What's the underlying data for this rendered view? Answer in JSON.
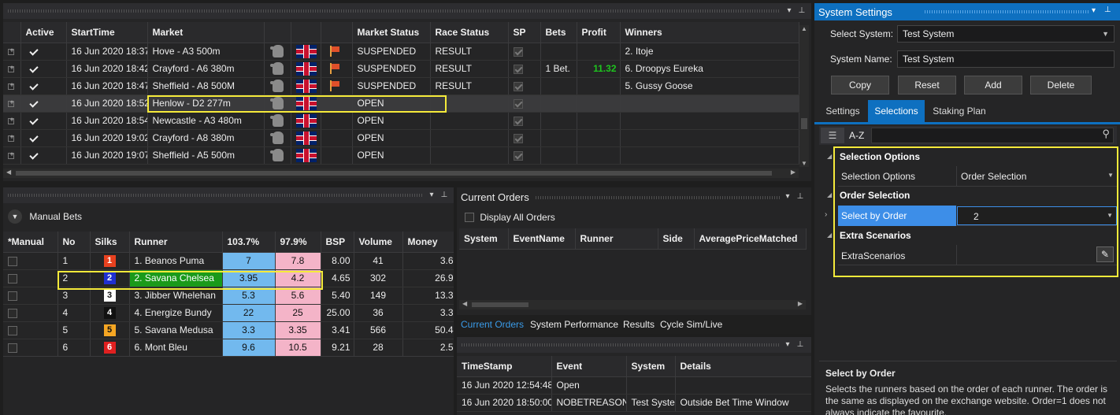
{
  "markets": {
    "headers": [
      "Active",
      "StartTime",
      "Market",
      "",
      "",
      "",
      "Market Status",
      "Race Status",
      "SP",
      "Bets",
      "Profit",
      "Winners"
    ],
    "rows": [
      {
        "time": "16 Jun 2020 18:37",
        "market": "Hove - A3 500m",
        "mstatus": "SUSPENDED",
        "rstatus": "RESULT",
        "bets": "",
        "profit": "",
        "winners": "2. Itoje",
        "flag": true
      },
      {
        "time": "16 Jun 2020 18:42",
        "market": "Crayford - A6 380m",
        "mstatus": "SUSPENDED",
        "rstatus": "RESULT",
        "bets": "1 Bet.",
        "profit": "11.32",
        "winners": "6. Droopys Eureka",
        "flag": true
      },
      {
        "time": "16 Jun 2020 18:47",
        "market": "Sheffield - A8 500M",
        "mstatus": "SUSPENDED",
        "rstatus": "RESULT",
        "bets": "",
        "profit": "",
        "winners": "5. Gussy Goose",
        "flag": true
      },
      {
        "time": "16 Jun 2020 18:52",
        "market": "Henlow - D2 277m",
        "mstatus": "OPEN",
        "rstatus": "",
        "bets": "",
        "profit": "",
        "winners": "",
        "flag": false
      },
      {
        "time": "16 Jun 2020 18:54",
        "market": "Newcastle - A3 480m",
        "mstatus": "OPEN",
        "rstatus": "",
        "bets": "",
        "profit": "",
        "winners": "",
        "flag": false
      },
      {
        "time": "16 Jun 2020 19:02",
        "market": "Crayford - A8 380m",
        "mstatus": "OPEN",
        "rstatus": "",
        "bets": "",
        "profit": "",
        "winners": "",
        "flag": false
      },
      {
        "time": "16 Jun 2020 19:07",
        "market": "Sheffield - A5 500m",
        "mstatus": "OPEN",
        "rstatus": "",
        "bets": "",
        "profit": "",
        "winners": "",
        "flag": false
      }
    ]
  },
  "manual": {
    "title": "Manual Bets",
    "headers": [
      "*Manual",
      "No",
      "Silks",
      "Runner",
      "103.7%",
      "97.9%",
      "BSP",
      "Volume",
      "Money"
    ],
    "rows": [
      {
        "no": "1",
        "silk": "1",
        "runner": "1. Beanos Puma",
        "back": "7",
        "lay": "7.8",
        "bsp": "8.00",
        "vol": "41",
        "money": "3.6",
        "silkbg": "#e8411f",
        "silkfg": "#fff"
      },
      {
        "no": "2",
        "silk": "2",
        "runner": "2. Savana Chelsea",
        "back": "3.95",
        "lay": "4.2",
        "bsp": "4.65",
        "vol": "302",
        "money": "26.9",
        "silkbg": "#1f2fd0",
        "silkfg": "#fff"
      },
      {
        "no": "3",
        "silk": "3",
        "runner": "3. Jibber Whelehan",
        "back": "5.3",
        "lay": "5.6",
        "bsp": "5.40",
        "vol": "149",
        "money": "13.3",
        "silkbg": "#ffffff",
        "silkfg": "#111"
      },
      {
        "no": "4",
        "silk": "4",
        "runner": "4. Energize Bundy",
        "back": "22",
        "lay": "25",
        "bsp": "25.00",
        "vol": "36",
        "money": "3.3",
        "silkbg": "#111111",
        "silkfg": "#fff"
      },
      {
        "no": "5",
        "silk": "5",
        "runner": "5. Savana Medusa",
        "back": "3.3",
        "lay": "3.35",
        "bsp": "3.41",
        "vol": "566",
        "money": "50.4",
        "silkbg": "#f5a623",
        "silkfg": "#111"
      },
      {
        "no": "6",
        "silk": "6",
        "runner": "6. Mont Bleu",
        "back": "9.6",
        "lay": "10.5",
        "bsp": "9.21",
        "vol": "28",
        "money": "2.5",
        "silkbg": "#e02020",
        "silkfg": "#fff"
      }
    ]
  },
  "orders": {
    "title": "Current Orders",
    "display_all": "Display All Orders",
    "headers": [
      "System",
      "EventName",
      "Runner",
      "Side",
      "AveragePriceMatched"
    ],
    "tabs": [
      "Current Orders",
      "System Performance",
      "Results",
      "Cycle Sim/Live"
    ]
  },
  "log": {
    "headers": [
      "TimeStamp",
      "Event",
      "System",
      "Details"
    ],
    "rows": [
      [
        "16 Jun 2020 12:54:48",
        "Open",
        "",
        ""
      ],
      [
        "16 Jun 2020 18:50:00",
        "NOBETREASONS",
        "Test Syster",
        "Outside Bet Time Window"
      ]
    ]
  },
  "settings": {
    "title": "System Settings",
    "select_system_label": "Select System:",
    "select_system_value": "Test System",
    "system_name_label": "System Name:",
    "system_name_value": "Test System",
    "buttons": [
      "Copy",
      "Reset",
      "Add",
      "Delete"
    ],
    "tabs": [
      "Settings",
      "Selections",
      "Staking Plan"
    ],
    "az": "A-Z",
    "sec1": "Selection Options",
    "p1_label": "Selection Options",
    "p1_value": "Order Selection",
    "sec2": "Order Selection",
    "p2_label": "Select by Order",
    "p2_value": "2",
    "sec3": "Extra Scenarios",
    "p3_label": "ExtraScenarios",
    "desc_title": "Select by Order",
    "desc_text": "Selects the runners based on the order of each runner. The order is the same as displayed on the exchange website. Order=1 does not always indicate the favourite."
  },
  "colors": {
    "accent": "#0e70c0",
    "highlight": "#f5ea3a",
    "back": "#72b9ee",
    "lay": "#f4b4c8",
    "profit": "#1ec41e",
    "selected_runner": "#1a9a1a"
  }
}
